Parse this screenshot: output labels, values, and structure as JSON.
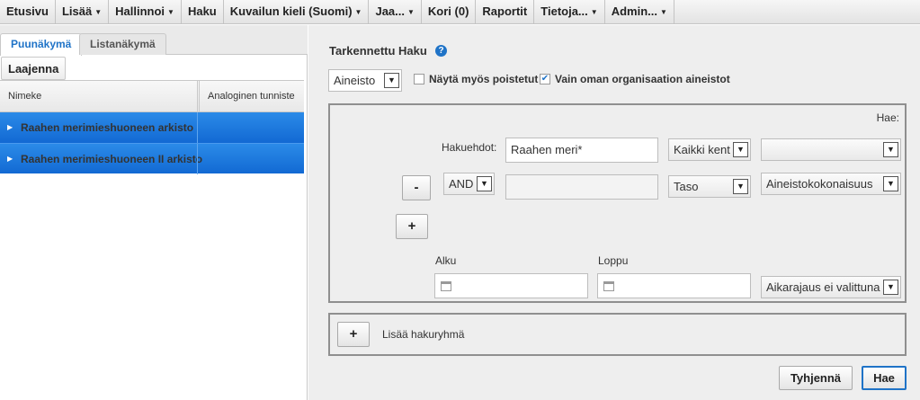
{
  "menu": [
    {
      "label": "Etusivu",
      "caret": false
    },
    {
      "label": "Lisää",
      "caret": true
    },
    {
      "label": "Hallinnoi",
      "caret": true
    },
    {
      "label": "Haku",
      "caret": false
    },
    {
      "label": "Kuvailun kieli (Suomi)",
      "caret": true
    },
    {
      "label": "Jaa...",
      "caret": true
    },
    {
      "label": "Kori (0)",
      "caret": false
    },
    {
      "label": "Raportit",
      "caret": false
    },
    {
      "label": "Tietoja...",
      "caret": true
    },
    {
      "label": "Admin...",
      "caret": true
    }
  ],
  "left": {
    "tabs": {
      "tree": "Puunäkymä",
      "list": "Listanäkymä"
    },
    "expand_button": "Laajenna",
    "columns": {
      "name": "Nimeke",
      "identifier": "Analoginen tunniste"
    },
    "rows": [
      {
        "name": "Raahen merimieshuoneen arkisto"
      },
      {
        "name": "Raahen merimieshuoneen II arkisto"
      }
    ]
  },
  "search": {
    "title": "Tarkennettu Haku",
    "help_icon": "?",
    "type_select": "Aineisto",
    "show_deleted_label": "Näytä myös poistetut",
    "show_deleted_checked": false,
    "own_org_label": "Vain oman organisaation aineistot",
    "own_org_checked": true,
    "hae_label": "Hae:",
    "criteria_label": "Hakuehdot:",
    "criteria_value": "Raahen meri*",
    "field_select": "Kaikki kent",
    "field_select2": "",
    "remove_button": "-",
    "operator": "AND",
    "criteria2_value": "",
    "level_select": "Taso",
    "level_value": "Aineistokokonaisuus",
    "add_button": "+",
    "start_label": "Alku",
    "end_label": "Loppu",
    "start_value": "",
    "end_value": "",
    "time_select": "Aikarajaus ei valittuna",
    "add_group_button": "+",
    "add_group_label": "Lisää hakuryhmä",
    "clear_button": "Tyhjennä",
    "search_button": "Hae"
  },
  "icons": {
    "dropdown": "chevron-down-icon",
    "calendar": "calendar-icon",
    "tree": "triangle-right-icon",
    "help": "question-icon"
  },
  "colors": {
    "accent": "#1f73c7",
    "row_selected": "#1a73dc",
    "panel_bg": "#eeeeee"
  }
}
